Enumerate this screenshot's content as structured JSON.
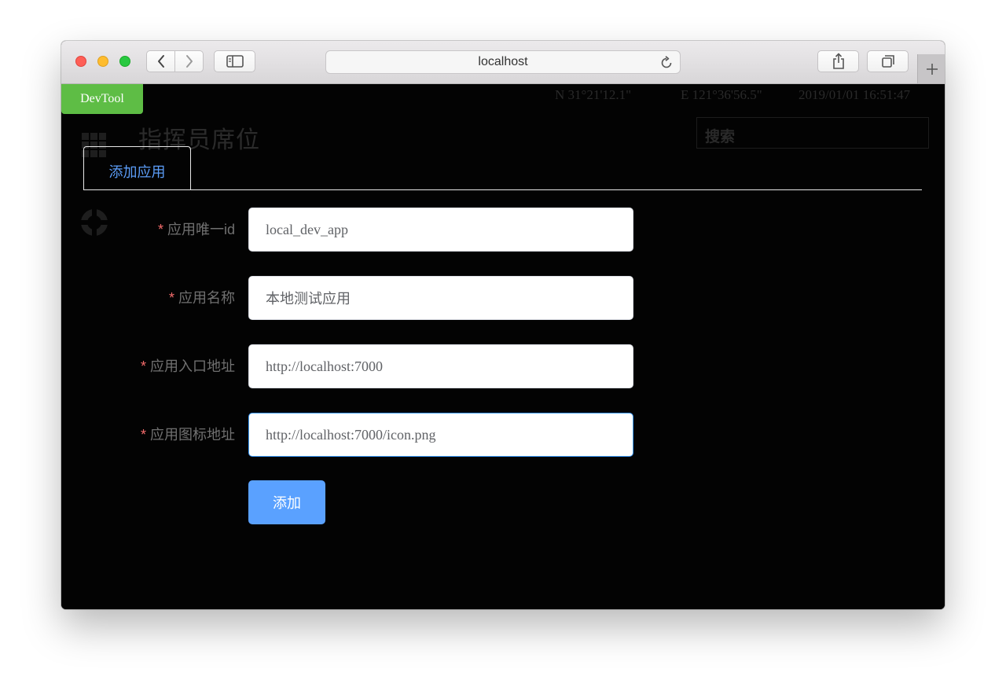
{
  "browser": {
    "url": "localhost"
  },
  "background": {
    "stats": [
      "N 31°21'12.1\"",
      "E 121°36'56.5\"",
      "2019/01/01 16:51:47"
    ],
    "title": "指挥员席位",
    "search_placeholder": "搜索"
  },
  "devtool": {
    "label": "DevTool"
  },
  "tab": {
    "label": "添加应用"
  },
  "form": {
    "required_mark": "*",
    "fields": [
      {
        "label": "应用唯一id",
        "value": "local_dev_app"
      },
      {
        "label": "应用名称",
        "value": "本地测试应用"
      },
      {
        "label": "应用入口地址",
        "value": "http://localhost:7000"
      },
      {
        "label": "应用图标地址",
        "value": "http://localhost:7000/icon.png"
      }
    ],
    "submit_label": "添加"
  },
  "colors": {
    "accent": "#5aa1ff",
    "tab_text": "#5b9cf7",
    "devtool": "#5ebd45",
    "required": "#f56c6c",
    "focus_border": "#409eff"
  }
}
